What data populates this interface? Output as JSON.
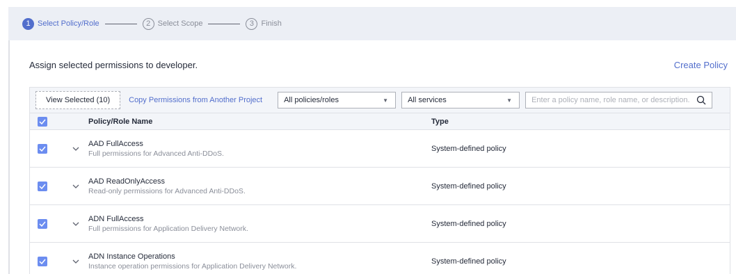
{
  "steps": [
    {
      "num": "1",
      "label": "Select Policy/Role",
      "active": true
    },
    {
      "num": "2",
      "label": "Select Scope",
      "active": false
    },
    {
      "num": "3",
      "label": "Finish",
      "active": false
    }
  ],
  "header": {
    "assign_text": "Assign selected permissions to developer.",
    "create_policy": "Create Policy"
  },
  "toolbar": {
    "view_selected": "View Selected (10)",
    "copy_permissions": "Copy Permissions from Another Project",
    "policy_filter": "All policies/roles",
    "service_filter": "All services",
    "search_placeholder": "Enter a policy name, role name, or description."
  },
  "table": {
    "columns": [
      "Policy/Role Name",
      "Type"
    ],
    "rows": [
      {
        "name": "AAD FullAccess",
        "description": "Full permissions for Advanced Anti-DDoS.",
        "type": "System-defined policy",
        "checked": true
      },
      {
        "name": "AAD ReadOnlyAccess",
        "description": "Read-only permissions for Advanced Anti-DDoS.",
        "type": "System-defined policy",
        "checked": true
      },
      {
        "name": "ADN FullAccess",
        "description": "Full permissions for Application Delivery Network.",
        "type": "System-defined policy",
        "checked": true
      },
      {
        "name": "ADN Instance Operations",
        "description": "Instance operation permissions for Application Delivery Network.",
        "type": "System-defined policy",
        "checked": true
      }
    ]
  },
  "colors": {
    "accent": "#526ecc",
    "checkbox": "#6c8df0"
  }
}
